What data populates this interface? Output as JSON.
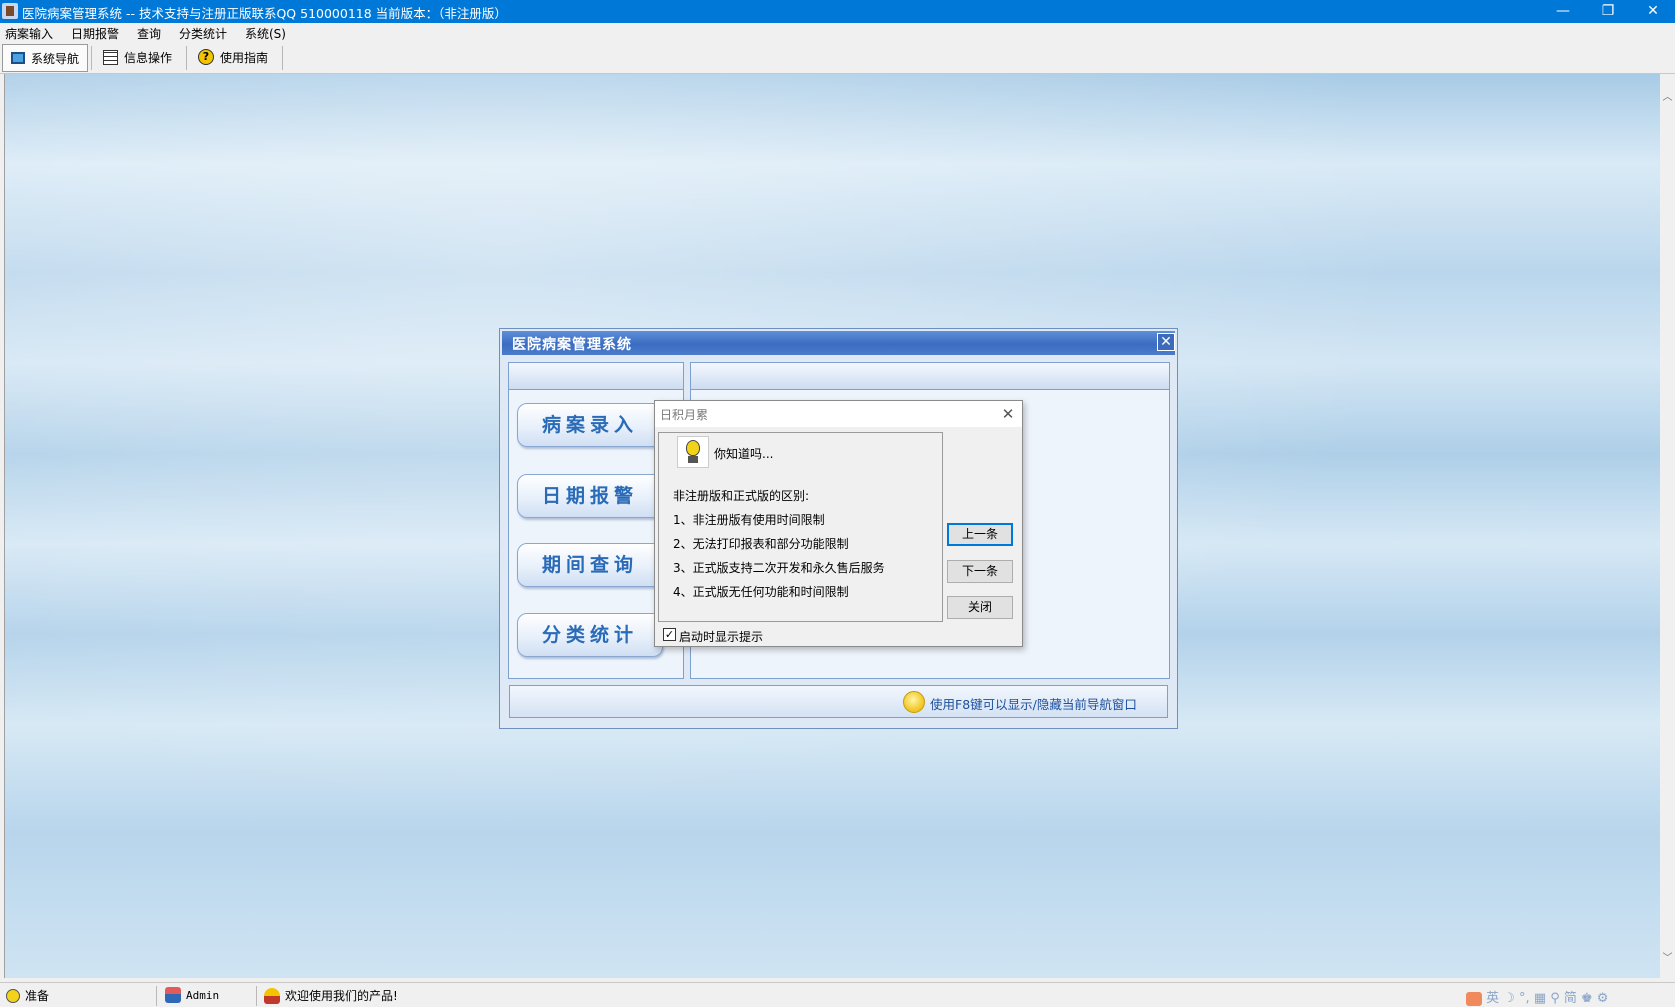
{
  "window": {
    "title": "医院病案管理系统 -- 技术支持与注册正版联系QQ 510000118     当前版本：（非注册版）",
    "minimize_glyph": "—",
    "restore_glyph": "❐",
    "close_glyph": "✕"
  },
  "menu": {
    "items": [
      "病案输入",
      "日期报警",
      "查询",
      "分类统计",
      "系统(S)"
    ]
  },
  "toolbar": {
    "items": [
      {
        "label": "系统导航",
        "icon": "monitor-icon",
        "active": true
      },
      {
        "label": "信息操作",
        "icon": "table-icon",
        "active": false
      },
      {
        "label": "使用指南",
        "icon": "help-icon",
        "active": false
      }
    ]
  },
  "navigator": {
    "title": "医院病案管理系统",
    "close_glyph": "✕",
    "buttons": [
      "病案录入",
      "日期报警",
      "期间查询",
      "分类统计"
    ],
    "footer_hint": "使用F8键可以显示/隐藏当前导航窗口"
  },
  "tip_dialog": {
    "title": "日积月累",
    "close_glyph": "✕",
    "heading": "你知道吗...",
    "lines": [
      "非注册版和正式版的区别:",
      "1、非注册版有使用时间限制",
      "2、无法打印报表和部分功能限制",
      "3、正式版支持二次开发和永久售后服务",
      "4、正式版无任何功能和时间限制"
    ],
    "buttons": {
      "prev": "上一条",
      "next": "下一条",
      "close": "关闭"
    },
    "show_on_startup_label": "启动时显示提示",
    "show_on_startup_checked": true,
    "check_glyph": "✓"
  },
  "statusbar": {
    "status": "准备",
    "user": "Admin",
    "message": "欢迎使用我们的产品!",
    "tray_text": "英 ☽ °, ▦ ⚲ 简 ♚ ⚙"
  },
  "colors": {
    "titlebar": "#0078d7",
    "nav_header": "#3a6cc2",
    "nav_button_text": "#2a6bb8",
    "focus_border": "#0078d7"
  }
}
